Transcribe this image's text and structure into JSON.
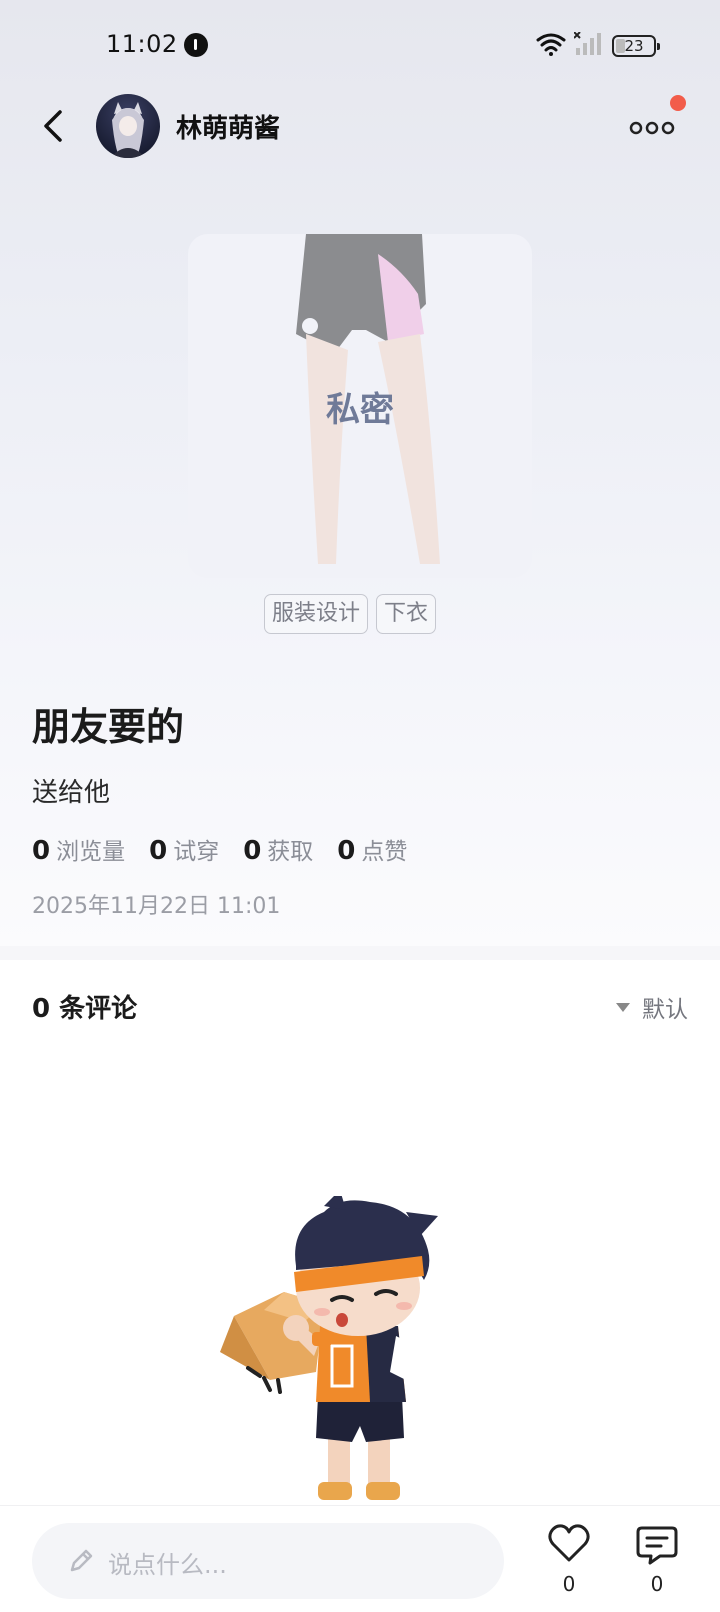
{
  "status_bar": {
    "time": "11:02",
    "battery": "23"
  },
  "header": {
    "username": "林萌萌酱"
  },
  "preview": {
    "private_label": "私密"
  },
  "tags": [
    "服装设计",
    "下衣"
  ],
  "post": {
    "title": "朋友要的",
    "description": "送给他",
    "stats": [
      {
        "num": "0",
        "label": "浏览量"
      },
      {
        "num": "0",
        "label": "试穿"
      },
      {
        "num": "0",
        "label": "获取"
      },
      {
        "num": "0",
        "label": "点赞"
      }
    ],
    "date": "2025年11月22日 11:01"
  },
  "comments": {
    "title": "0 条评论",
    "sort_label": "默认"
  },
  "bottom_bar": {
    "input_placeholder": "说点什么...",
    "like_count": "0",
    "comment_count": "0"
  },
  "colors": {
    "accent_red": "#f25c4a",
    "private_text": "#6f7a98"
  }
}
